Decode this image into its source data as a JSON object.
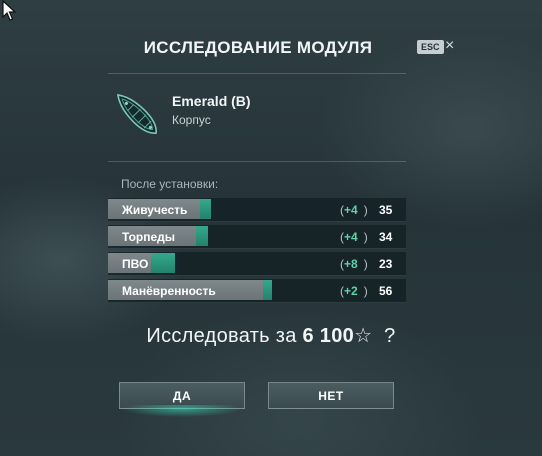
{
  "dialog": {
    "title": "ИССЛЕДОВАНИЕ МОДУЛЯ",
    "esc_label": "ESC",
    "close_glyph": "×"
  },
  "module": {
    "name": "Emerald (B)",
    "type": "Корпус",
    "icon": "hull-icon"
  },
  "after_install_label": "После установки:",
  "stats": [
    {
      "name": "Живучесть",
      "delta": "+4",
      "value": "35",
      "base_fraction": 0.31,
      "new_fraction": 0.345
    },
    {
      "name": "Торпеды",
      "delta": "+4",
      "value": "34",
      "base_fraction": 0.295,
      "new_fraction": 0.335
    },
    {
      "name": "ПВО",
      "delta": "+8",
      "value": "23",
      "base_fraction": 0.145,
      "new_fraction": 0.225
    },
    {
      "name": "Манёвренность",
      "delta": "+2",
      "value": "56",
      "base_fraction": 0.52,
      "new_fraction": 0.55
    }
  ],
  "paren_open": "(",
  "paren_close": ")",
  "question": {
    "prefix": "Исследовать за",
    "price": "6 100",
    "currency_icon": "star-icon",
    "currency_glyph": "☆",
    "suffix": "?"
  },
  "buttons": {
    "yes": "ДА",
    "no": "НЕТ"
  },
  "colors": {
    "accent_green": "#5fd1a9",
    "bar_increase": "#2a9a7e",
    "bar_base": "#7b8588"
  }
}
